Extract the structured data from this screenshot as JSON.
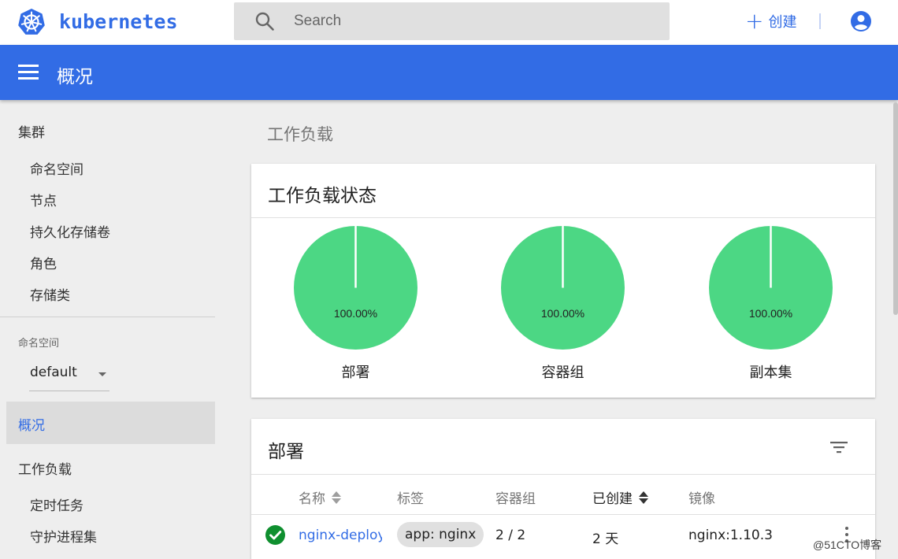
{
  "header": {
    "brand": "kubernetes",
    "search_placeholder": "Search",
    "create_label": "创建"
  },
  "titlebar": {
    "title": "概况"
  },
  "sidebar": {
    "cluster_heading": "集群",
    "cluster_items": [
      "命名空间",
      "节点",
      "持久化存储卷",
      "角色",
      "存储类"
    ],
    "namespace_label": "命名空间",
    "namespace_value": "default",
    "overview": "概况",
    "workloads_heading": "工作负载",
    "workload_items": [
      "定时任务",
      "守护进程集"
    ]
  },
  "main": {
    "section_title": "工作负载",
    "status_card": {
      "title": "工作负载状态",
      "charts": [
        {
          "name": "部署",
          "percent_label": "100.00%",
          "value": 100,
          "color": "#4cd784"
        },
        {
          "name": "容器组",
          "percent_label": "100.00%",
          "value": 100,
          "color": "#4cd784"
        },
        {
          "name": "副本集",
          "percent_label": "100.00%",
          "value": 100,
          "color": "#4cd784"
        }
      ]
    },
    "deployments_card": {
      "title": "部署",
      "columns": [
        "名称",
        "标签",
        "容器组",
        "已创建",
        "镜像"
      ],
      "rows": [
        {
          "name": "nginx-deployment",
          "label": "app: nginx",
          "pods": "2 / 2",
          "created": "2 天",
          "image": "nginx:1.10.3"
        }
      ]
    }
  },
  "watermark": "@51CTO博客",
  "colors": {
    "brand_blue": "#326ce5",
    "success_green": "#0f8f2f",
    "pie_green": "#4cd784"
  }
}
